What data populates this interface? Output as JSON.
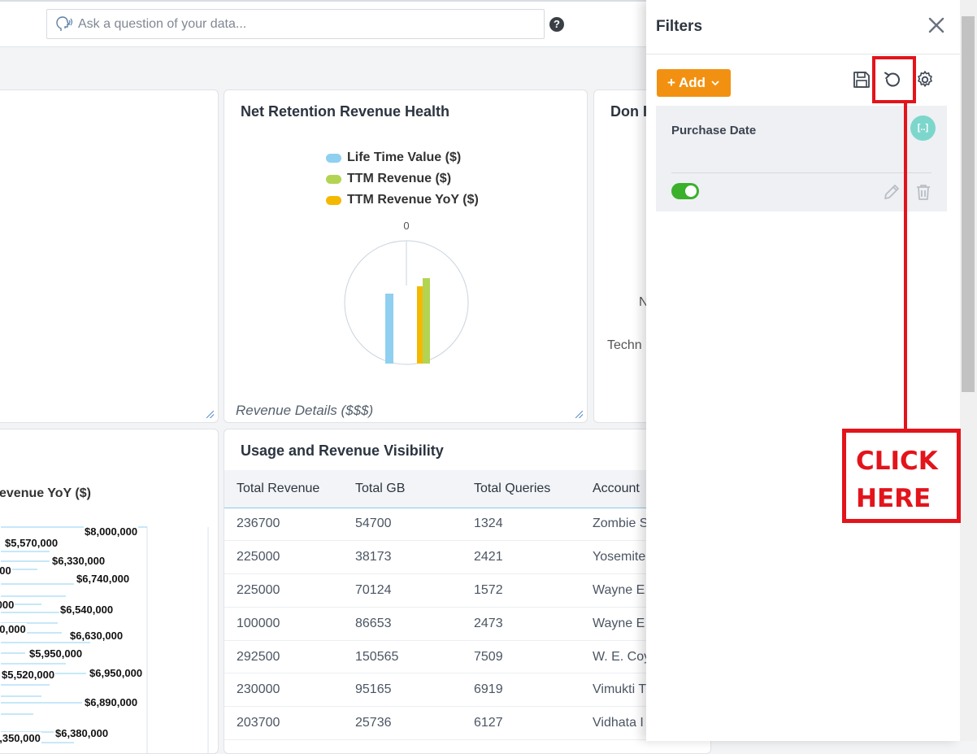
{
  "header": {
    "search_placeholder": "Ask a question of your data...",
    "help_icon": "question-circle-icon"
  },
  "cards": {
    "net_retention": {
      "title": "Net Retention Revenue Health",
      "legend": [
        {
          "label": "Life Time Value ($)",
          "color": "#8fd0f0"
        },
        {
          "label": "TTM Revenue ($)",
          "color": "#b3d453"
        },
        {
          "label": "TTM Revenue YoY ($)",
          "color": "#f5b800"
        }
      ],
      "axis_zero_label": "0",
      "footer": "Revenue Details ($$$)"
    },
    "partial_right": {
      "title": "Don I",
      "text_n": "N",
      "text_techn": "Techn"
    },
    "partial_bottom_left": {
      "title": "evenue YoY ($)",
      "bar_labels": [
        "$8,000,000",
        "$5,570,000",
        "$6,330,000",
        "000",
        "$6,740,000",
        ",000",
        "$6,540,000",
        "30,000",
        "$6,630,000",
        "$5,950,000",
        "$5,520,000",
        "$6,950,000",
        "$6,890,000",
        "$6,380,000",
        "5,350,000"
      ]
    },
    "usage": {
      "title": "Usage and Revenue Visibility",
      "columns": [
        "Total Revenue",
        "Total GB",
        "Total Queries",
        "Account"
      ],
      "rows": [
        [
          "236700",
          "54700",
          "1324",
          "Zombie S"
        ],
        [
          "225000",
          "38173",
          "2421",
          "Yosemite"
        ],
        [
          "225000",
          "70124",
          "1572",
          "Wayne E"
        ],
        [
          "100000",
          "86653",
          "2473",
          "Wayne E"
        ],
        [
          "292500",
          "150565",
          "7509",
          "W. E. Coy"
        ],
        [
          "230000",
          "95165",
          "6919",
          "Vimukti T"
        ],
        [
          "203700",
          "25736",
          "6127",
          "Vidhata I"
        ]
      ]
    }
  },
  "filters": {
    "title": "Filters",
    "add_label": "+ Add",
    "icons": [
      "save-icon",
      "reset-icon",
      "settings-icon"
    ],
    "items": [
      {
        "name": "Purchase Date",
        "badge": "[..]",
        "enabled": true
      }
    ]
  },
  "annotation": {
    "line1": "CLICK",
    "line2": "HERE",
    "color": "#e3141b"
  },
  "chart_data": {
    "type": "bar",
    "title": "Net Retention Revenue Health",
    "series": [
      {
        "name": "Life Time Value ($)",
        "color": "#8fd0f0"
      },
      {
        "name": "TTM Revenue ($)",
        "color": "#b3d453"
      },
      {
        "name": "TTM Revenue YoY ($)",
        "color": "#f5b800"
      }
    ],
    "tick_labels": [
      "0"
    ],
    "legend_position": "top"
  }
}
